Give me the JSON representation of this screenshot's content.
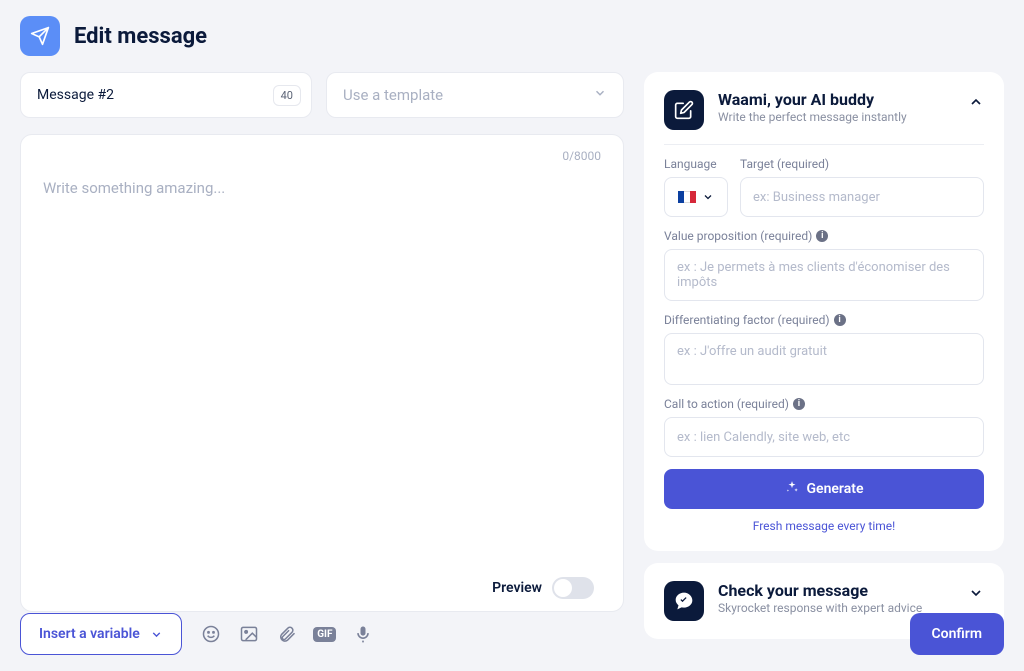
{
  "header": {
    "title": "Edit message"
  },
  "message": {
    "name": "Message #2",
    "name_max_badge": "40"
  },
  "template": {
    "placeholder": "Use a template"
  },
  "editor": {
    "placeholder": "Write something amazing...",
    "counter": "0/8000"
  },
  "waami": {
    "title": "Waami, your AI buddy",
    "subtitle": "Write the perfect message instantly",
    "labels": {
      "language": "Language",
      "target": "Target (required)",
      "value_prop": "Value proposition (required)",
      "diff": "Differentiating factor (required)",
      "cta": "Call to action (required)"
    },
    "placeholders": {
      "target": "ex: Business manager",
      "value_prop": "ex : Je permets à mes clients d'économiser des impôts",
      "diff": "ex : J'offre un audit gratuit",
      "cta": "ex : lien Calendly, site web, etc"
    },
    "generate_label": "Generate",
    "fresh_note": "Fresh message every time!"
  },
  "check_panel": {
    "title": "Check your message",
    "subtitle": "Skyrocket response with expert advice"
  },
  "footer": {
    "preview_label": "Preview",
    "insert_variable_label": "Insert a variable",
    "confirm_label": "Confirm",
    "gif_label": "GIF"
  }
}
